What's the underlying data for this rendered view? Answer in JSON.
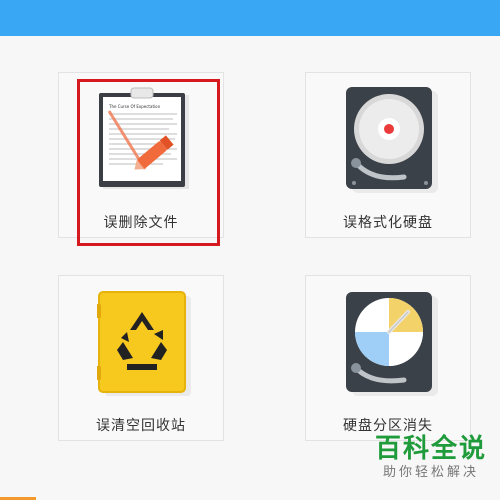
{
  "header": {
    "color": "#3aa7f5"
  },
  "cards": [
    {
      "label": "误删除文件",
      "icon": "document-clipboard-icon"
    },
    {
      "label": "误格式化硬盘",
      "icon": "hard-disk-icon"
    },
    {
      "label": "误清空回收站",
      "icon": "recycle-bin-icon"
    },
    {
      "label": "硬盘分区消失",
      "icon": "partition-disk-icon"
    }
  ],
  "document_heading": "The Curse Of Expectation",
  "selection_color": "#d6191e",
  "watermark": {
    "main": "百科全说",
    "sub": "助你轻松解决"
  }
}
